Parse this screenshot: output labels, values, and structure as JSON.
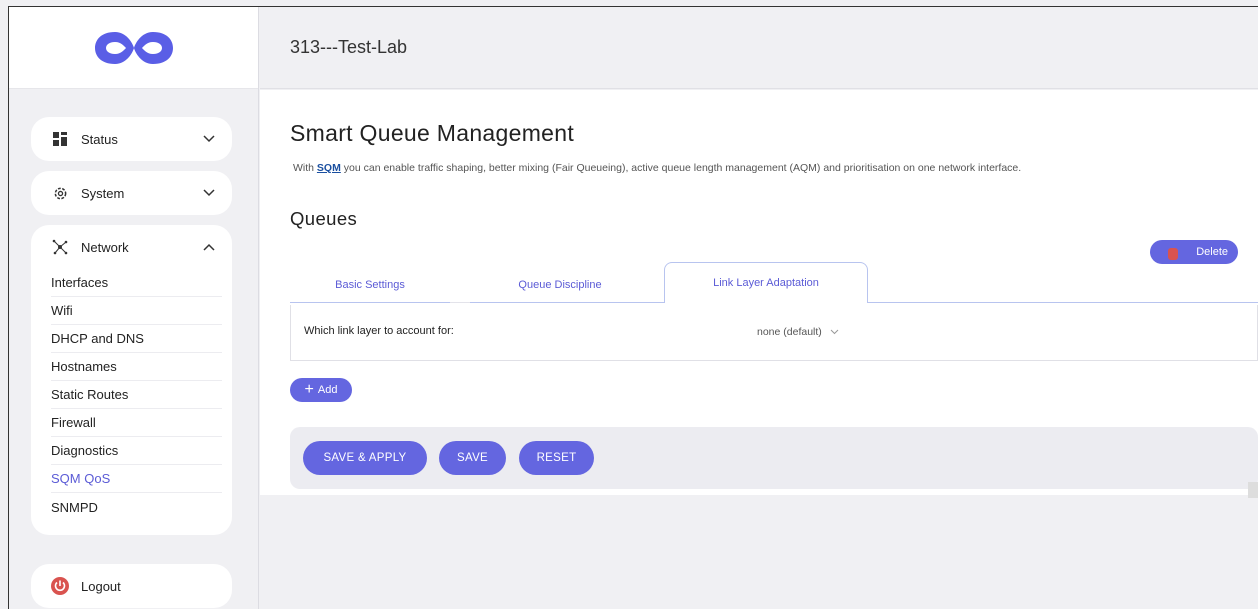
{
  "header": {
    "device_name": "313---Test-Lab"
  },
  "sidebar": {
    "status": {
      "label": "Status"
    },
    "system": {
      "label": "System"
    },
    "network": {
      "label": "Network",
      "items": [
        {
          "label": "Interfaces"
        },
        {
          "label": "Wifi"
        },
        {
          "label": "DHCP and DNS"
        },
        {
          "label": "Hostnames"
        },
        {
          "label": "Static Routes"
        },
        {
          "label": "Firewall"
        },
        {
          "label": "Diagnostics"
        },
        {
          "label": "SQM QoS"
        },
        {
          "label": "SNMPD"
        }
      ]
    },
    "logout": {
      "label": "Logout"
    }
  },
  "main": {
    "title": "Smart Queue Management",
    "description_pre": "With ",
    "description_link": "SQM",
    "description_post": " you can enable traffic shaping, better mixing (Fair Queueing), active queue length management (AQM) and prioritisation on one network interface.",
    "queues_title": "Queues",
    "delete_label": "Delete",
    "tabs": [
      {
        "label": "Basic Settings"
      },
      {
        "label": "Queue Discipline"
      },
      {
        "label": "Link Layer Adaptation"
      }
    ],
    "setting": {
      "label": "Which link layer to account for:",
      "value": "none (default)"
    },
    "add_label": "Add",
    "actions": {
      "save_apply": "SAVE & APPLY",
      "save": "SAVE",
      "reset": "RESET"
    }
  },
  "colors": {
    "accent": "#6466e0",
    "active_link": "#5b5bd6",
    "logout_icon": "#d9534f"
  }
}
